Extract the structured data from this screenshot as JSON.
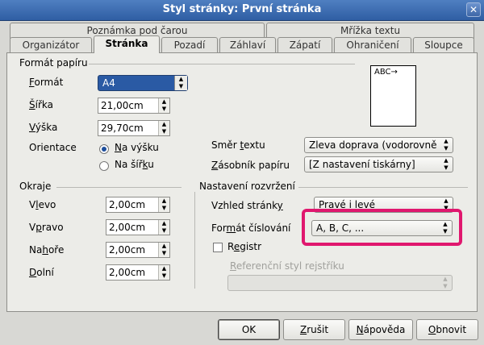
{
  "window": {
    "title": "Styl stránky: První stránka",
    "close_glyph": "✕"
  },
  "tabs": {
    "back_row": [
      "Poznámka pod čarou",
      "Mřížka textu"
    ],
    "front_row": [
      "Organizátor",
      "Stránka",
      "Pozadí",
      "Záhlaví",
      "Zápatí",
      "Ohraničení",
      "Sloupce"
    ],
    "active": "Stránka"
  },
  "paper_format": {
    "section_title": "Formát papíru",
    "format_label": "Formát",
    "format_value": "A4",
    "width_label": "Šířka",
    "width_value": "21,00cm",
    "height_label": "Výška",
    "height_value": "29,70cm",
    "orientation_label": "Orientace",
    "portrait_label": "Na výšku",
    "landscape_label": "Na šířku",
    "orientation_selected": "Na výšku",
    "text_direction_label": "Směr textu",
    "text_direction_value": "Zleva doprava (vodorovně",
    "paper_tray_label": "Zásobník papíru",
    "paper_tray_value": "[Z nastavení tiskárny]",
    "preview_text": "ABC→"
  },
  "margins": {
    "section_title": "Okraje",
    "left_label": "Vlevo",
    "left_value": "2,00cm",
    "right_label": "Vpravo",
    "right_value": "2,00cm",
    "top_label": "Nahoře",
    "top_value": "2,00cm",
    "bottom_label": "Dolní",
    "bottom_value": "2,00cm"
  },
  "layout_settings": {
    "section_title": "Nastavení rozvržení",
    "page_layout_label": "Vzhled stránky",
    "page_layout_value": "Pravé i levé",
    "numbering_label": "Formát číslování",
    "numbering_value": "A, B, C, ...",
    "register_label": "Registr",
    "register_checked": false,
    "reference_style_label": "Referenční styl rejstříku",
    "reference_style_value": ""
  },
  "buttons": {
    "ok": "OK",
    "cancel": "Zrušit",
    "help": "Nápověda",
    "reset": "Obnovit"
  },
  "colors": {
    "highlight": "#e0176e",
    "titlebar": "#3a69ad"
  }
}
